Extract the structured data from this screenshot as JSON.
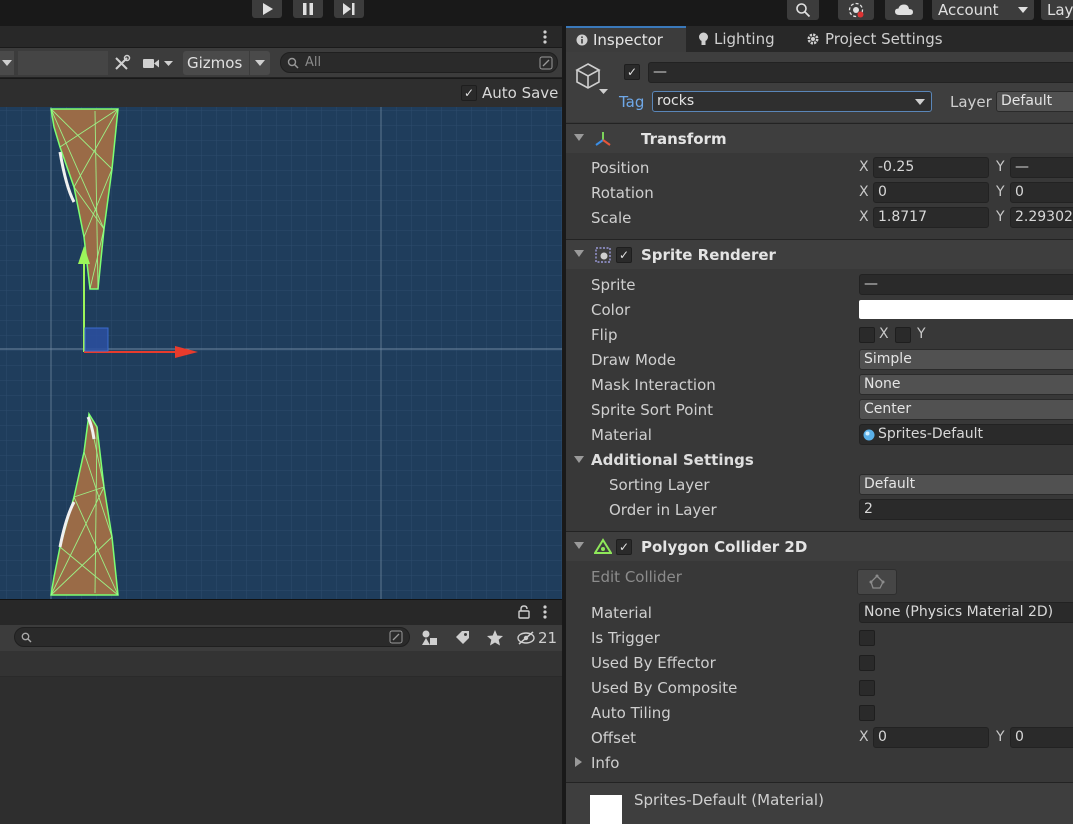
{
  "toolbar": {
    "play_icon": "play-icon",
    "pause_icon": "pause-icon",
    "step_icon": "step-icon",
    "search_icon": "search-icon",
    "collab_icon": "collab-icon",
    "cloud_icon": "cloud-icon",
    "account_label": "Account",
    "layers_label": "Lay"
  },
  "scene": {
    "gizmos_label": "Gizmos",
    "search_placeholder": "All",
    "autosave_label": "Auto Save",
    "autosave_checked": true,
    "colors": {
      "background": "#1f3d5c",
      "rock": "#9a6b47",
      "outline": "#7dff72",
      "x_axis": "#e83b2c",
      "y_axis": "#9cf55a"
    }
  },
  "lower_panel": {
    "hidden_count": "21"
  },
  "inspector": {
    "tabs": [
      {
        "label": "Inspector",
        "icon": "info-icon"
      },
      {
        "label": "Lighting",
        "icon": "bulb-icon"
      },
      {
        "label": "Project Settings",
        "icon": "gear-icon"
      }
    ],
    "object_name": "—",
    "tag_label": "Tag",
    "tag_value": "rocks",
    "layer_label": "Layer",
    "layer_value": "Default",
    "transform": {
      "title": "Transform",
      "position_label": "Position",
      "rotation_label": "Rotation",
      "scale_label": "Scale",
      "position": {
        "x": "-0.25",
        "y": "—"
      },
      "rotation": {
        "x": "0",
        "y": "0"
      },
      "scale": {
        "x": "1.8717",
        "y": "2.29302"
      }
    },
    "sprite_renderer": {
      "title": "Sprite Renderer",
      "sprite_label": "Sprite",
      "sprite_value": "—",
      "color_label": "Color",
      "color_value": "#ffffff",
      "flip_label": "Flip",
      "flip_x": "X",
      "flip_y": "Y",
      "draw_mode_label": "Draw Mode",
      "draw_mode_value": "Simple",
      "mask_label": "Mask Interaction",
      "mask_value": "None",
      "sort_point_label": "Sprite Sort Point",
      "sort_point_value": "Center",
      "material_label": "Material",
      "material_value": "Sprites-Default",
      "additional_label": "Additional Settings",
      "sorting_layer_label": "Sorting Layer",
      "sorting_layer_value": "Default",
      "order_label": "Order in Layer",
      "order_value": "2"
    },
    "polygon_collider": {
      "title": "Polygon Collider 2D",
      "edit_label": "Edit Collider",
      "material_label": "Material",
      "material_value": "None (Physics Material 2D)",
      "trigger_label": "Is Trigger",
      "effector_label": "Used By Effector",
      "composite_label": "Used By Composite",
      "tiling_label": "Auto Tiling",
      "offset_label": "Offset",
      "offset": {
        "x": "0",
        "y": "0"
      },
      "info_label": "Info"
    },
    "material_preview": {
      "title": "Sprites-Default (Material)"
    }
  }
}
